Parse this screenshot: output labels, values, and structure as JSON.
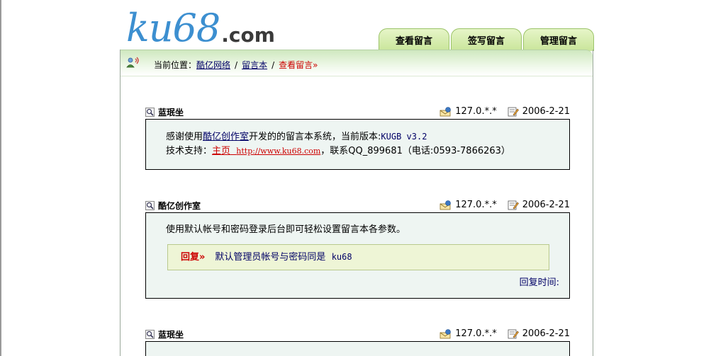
{
  "logo": {
    "main": "ku68",
    "suffix": ".com"
  },
  "tabs": [
    {
      "label": "查看留言"
    },
    {
      "label": "签写留言"
    },
    {
      "label": "管理留言"
    }
  ],
  "breadcrumb": {
    "prefix": "当前位置：",
    "items": [
      "酷亿网络",
      "留言本"
    ],
    "separator": "/",
    "current": "查看留言»"
  },
  "entries": [
    {
      "name": "蓝珉坐",
      "ip": "127.0.*.*",
      "date": "2006-2-21",
      "line1_pre": "感谢使用",
      "line1_link": "酷亿创作室",
      "line1_post": "开发的的留言本系统，当前版本:",
      "line1_version": "KUGB  v3.2",
      "line2_pre": "技术支持：",
      "line2_link_label": "主页",
      "line2_link_url": "http://www.ku68.com",
      "line2_post": "，联系QQ_899681（电话:0593-7866263）"
    },
    {
      "name": "酷亿创作室",
      "ip": "127.0.*.*",
      "date": "2006-2-21",
      "content": "使用默认帐号和密码登录后台即可轻松设置留言本各参数。",
      "reply_label": "回复»",
      "reply_text": "默认管理员帐号与密码同是",
      "reply_code": "ku68",
      "reply_time_label": "回复时间:"
    },
    {
      "name": "蓝珉坐",
      "ip": "127.0.*.*",
      "date": "2006-2-21"
    }
  ]
}
